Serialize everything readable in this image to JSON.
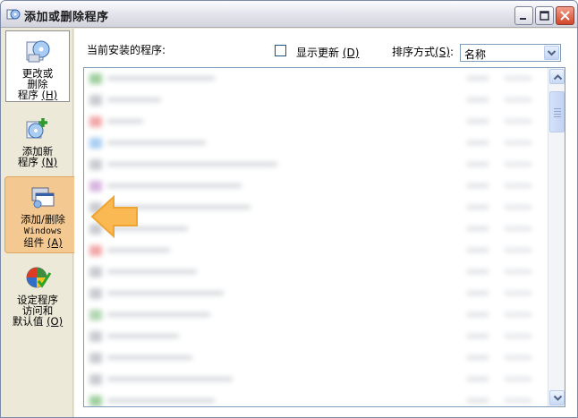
{
  "window": {
    "title": "添加或删除程序",
    "accent_color": "#7a8aa8"
  },
  "sidebar": {
    "items": [
      {
        "label_line1": "更改或",
        "label_line2": "删除",
        "label_line3": "程序",
        "hotkey": "(H)",
        "icon": "change-remove-programs-icon"
      },
      {
        "label_line1": "添加新",
        "label_line2": "程序",
        "hotkey": "(N)",
        "icon": "add-new-programs-icon"
      },
      {
        "label_line1": "添加/删除",
        "label_line2": "Windows",
        "label_line3": "组件",
        "hotkey": "(A)",
        "icon": "windows-components-icon",
        "highlight_color": "#f5c78e"
      },
      {
        "label_line1": "设定程序",
        "label_line2": "访问和",
        "label_line3": "默认值",
        "hotkey": "(O)",
        "icon": "program-access-defaults-icon"
      }
    ]
  },
  "main": {
    "current_label": "当前安装的程序:",
    "show_updates_label": "显示更新",
    "show_updates_hotkey": "(D)",
    "sort_label": "排序方式",
    "sort_hotkey": "(S)",
    "sort_colon": ":",
    "sort_value": "名称"
  }
}
